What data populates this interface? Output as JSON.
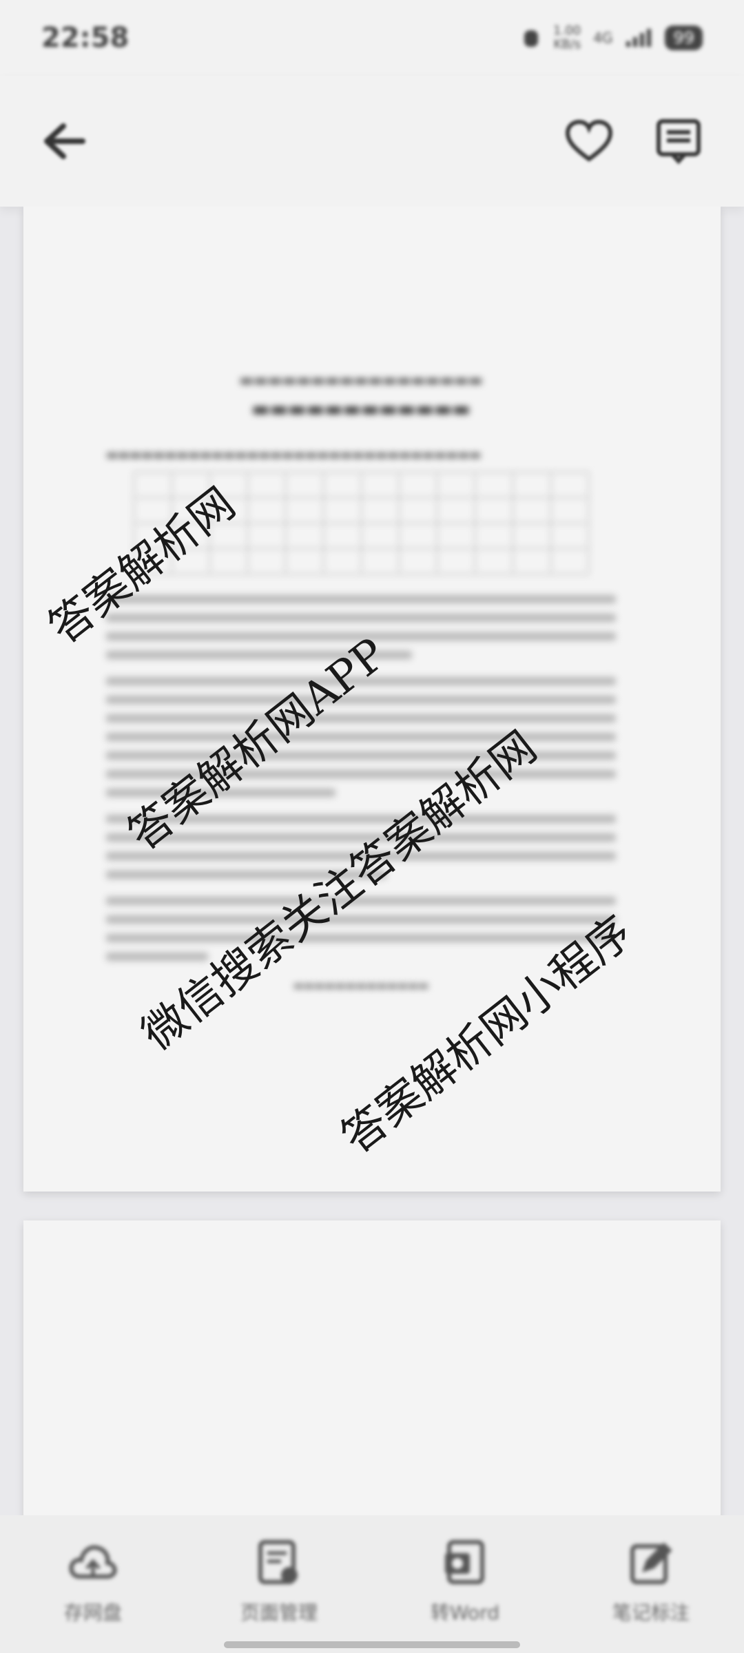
{
  "status_bar": {
    "time": "22:58",
    "speed_top": "1.00",
    "speed_bottom": "KB/s",
    "network": "4G",
    "battery": "99"
  },
  "toolbar": {
    "back_icon": "arrow-left-icon",
    "favorite_icon": "heart-icon",
    "menu_icon": "document-menu-icon"
  },
  "watermarks": [
    "答案解析网",
    "答案解析网APP",
    "微信搜索关注答案解析网",
    "答案解析网小程序"
  ],
  "bottom_nav": [
    {
      "label": "存网盘",
      "icon": "cloud-save-icon"
    },
    {
      "label": "页面管理",
      "icon": "page-manage-icon"
    },
    {
      "label": "转Word",
      "icon": "convert-word-icon"
    },
    {
      "label": "笔记标注",
      "icon": "note-edit-icon"
    }
  ]
}
